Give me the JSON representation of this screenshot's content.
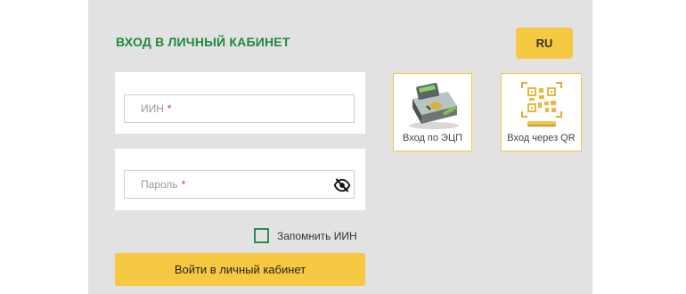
{
  "header": {
    "title": "ВХОД В ЛИЧНЫЙ КАБИНЕТ",
    "lang_label": "RU"
  },
  "form": {
    "iin_placeholder": "ИИН",
    "password_placeholder": "Пароль",
    "required_mark": "*",
    "remember_label": "Запомнить ИИН",
    "remember_checked": false,
    "submit_label": "Войти в личный кабинет"
  },
  "methods": [
    {
      "label": "Вход по ЭЦП",
      "icon": "ecp-card-reader-icon"
    },
    {
      "label": "Вход через QR",
      "icon": "qr-code-icon"
    }
  ],
  "colors": {
    "accent_yellow": "#f7c943",
    "title_green": "#1f8a3c",
    "panel_bg": "#e2e2e2"
  }
}
